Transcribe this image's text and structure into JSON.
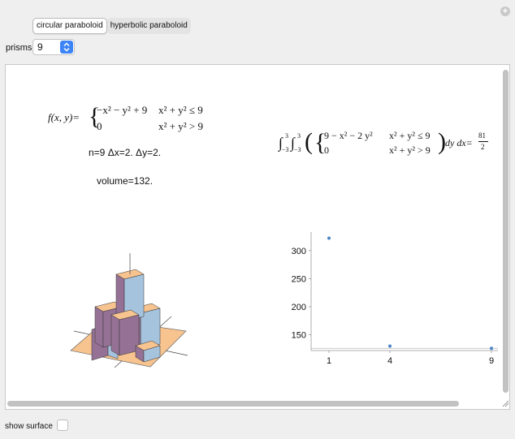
{
  "tabs": [
    {
      "label": "circular paraboloid",
      "active": true
    },
    {
      "label": "hyperbolic paraboloid",
      "active": false
    }
  ],
  "controls": {
    "prisms_label": "prisms",
    "prisms_value": "9",
    "show_surface_label": "show surface",
    "show_surface_checked": false
  },
  "panel": {
    "function_lhs": "f(x, y)=",
    "case1_expr": "−x² − y² + 9",
    "case1_cond": "x² + y² ≤ 9",
    "case2_expr": "0",
    "case2_cond": "x² + y² > 9",
    "params": "n=9 Δx=2. Δy=2.",
    "volume": "volume=132.",
    "integral_bounds_lower": "−3",
    "integral_bounds_upper": "3",
    "integral_case1_expr": "9 − x² − 2 y²",
    "integral_case1_cond": "x² + y² ≤ 9",
    "integral_case2_expr": "0",
    "integral_case2_cond": "x² + y² > 9",
    "integral_diff": "dy dx=",
    "integral_result_num": "81",
    "integral_result_den": "2"
  },
  "chart_data": {
    "type": "scatter",
    "x": [
      1,
      4,
      9
    ],
    "y": [
      322,
      130,
      126
    ],
    "xticks": [
      "1",
      "4",
      "9"
    ],
    "yticks": [
      "150",
      "200",
      "250",
      "300"
    ],
    "reference_line": 126,
    "color": "#4a86c8"
  },
  "colors": {
    "prism_front": "#957295",
    "prism_side": "#a6c3de",
    "prism_top": "#f7c38f",
    "base": "#f7c38f"
  }
}
